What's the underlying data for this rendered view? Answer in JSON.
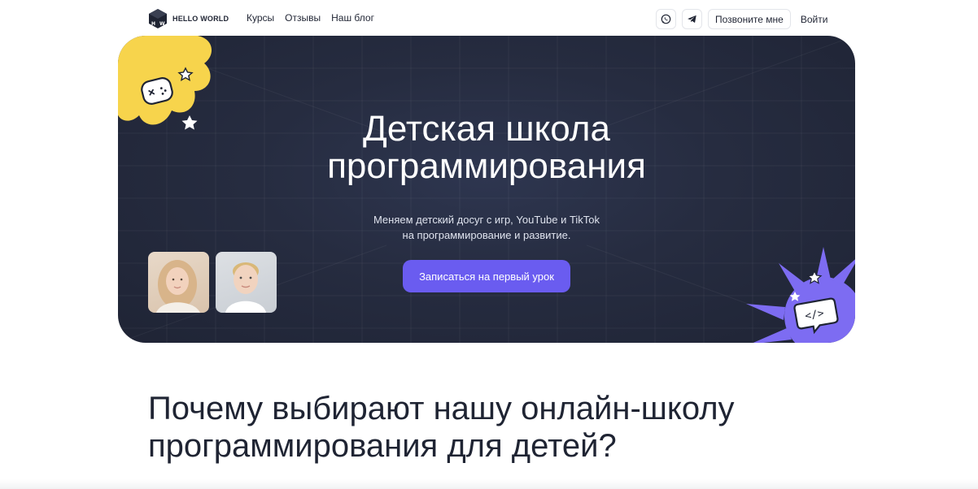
{
  "header": {
    "logo_text": "HELLO WORLD",
    "nav": [
      "Курсы",
      "Отзывы",
      "Наш блог"
    ],
    "call_label": "Позвоните мне",
    "login_label": "Войти",
    "icons": [
      "whatsapp-icon",
      "telegram-icon"
    ]
  },
  "hero": {
    "title_line1": "Детская школа",
    "title_line2": "программирования",
    "subtitle_line1": "Меняем детский досуг с игр, YouTube и TikTok",
    "subtitle_line2": "на программирование и развитие.",
    "cta_label": "Записаться на первый урок"
  },
  "section": {
    "title_line1": "Почему выбирают нашу онлайн-школу",
    "title_line2": "программирования для детей?"
  },
  "colors": {
    "hero_bg": "#262c40",
    "accent": "#6a5cf0",
    "yellow_blob": "#f7d44c",
    "purple_blob": "#7d6cf2",
    "text_dark": "#1f2433"
  }
}
